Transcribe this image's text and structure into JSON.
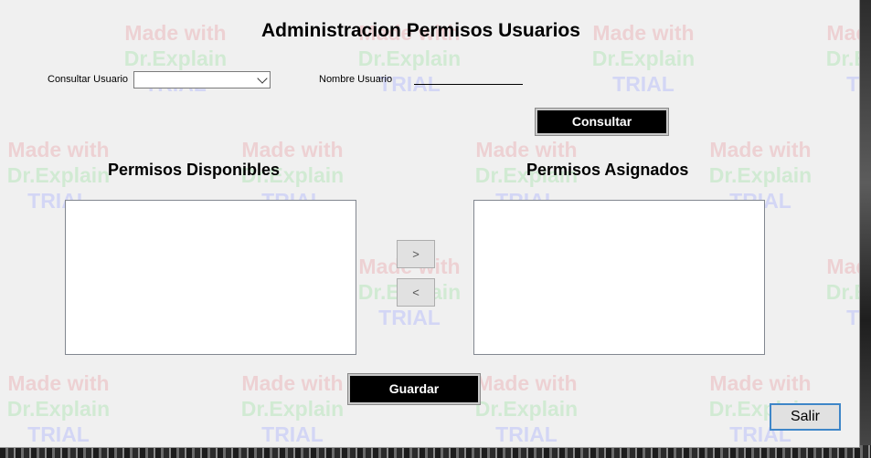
{
  "window": {
    "title": "Administracion Permisos Usuarios"
  },
  "watermark": {
    "line1": "Made with",
    "line2": "Dr.Explain",
    "line3": "TRIAL"
  },
  "form": {
    "consultar_usuario_label": "Consultar Usuario",
    "usuario_combo_value": "",
    "nombre_usuario_label": "Nombre Usuario",
    "nombre_usuario_value": "",
    "consultar_button": "Consultar"
  },
  "disponibles": {
    "title": "Permisos Disponibles",
    "items": []
  },
  "asignados": {
    "title": "Permisos Asignados",
    "items": []
  },
  "transfer": {
    "add_label": ">",
    "remove_label": "<"
  },
  "actions": {
    "guardar_label": "Guardar",
    "salir_label": "Salir"
  },
  "colors": {
    "window_bg": "#f0f0f0",
    "primary_button_bg": "#000000",
    "primary_button_text": "#ffffff",
    "focus_border": "#3e86c8"
  }
}
